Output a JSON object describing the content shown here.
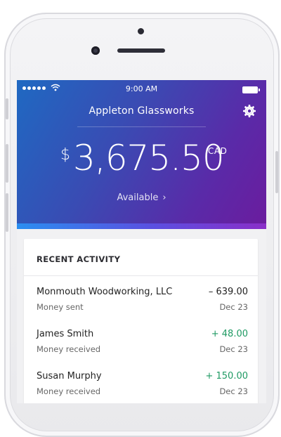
{
  "status_bar": {
    "time": "9:00 AM"
  },
  "account": {
    "name": "Appleton Glassworks",
    "currency_symbol": "$",
    "balance": "3,675.50",
    "currency": "CAD",
    "available_label": "Available",
    "available_chevron": "›"
  },
  "activity": {
    "title": "RECENT ACTIVITY",
    "items": [
      {
        "name": "Monmouth Woodworking, LLC",
        "type": "Money sent",
        "amount": "– 639.00",
        "date": "Dec 23",
        "direction": "out"
      },
      {
        "name": "James Smith",
        "type": "Money received",
        "amount": "+ 48.00",
        "date": "Dec 23",
        "direction": "in"
      },
      {
        "name": "Susan Murphy",
        "type": "Money received",
        "amount": "+ 150.00",
        "date": "Dec 23",
        "direction": "in"
      }
    ]
  },
  "icons": {
    "settings": "gear-icon",
    "wifi": "wifi-icon",
    "battery": "battery-icon",
    "signal": "signal-icon"
  },
  "colors": {
    "header_start": "#1f69c2",
    "header_end": "#6b1c9e",
    "positive": "#1f9a63"
  }
}
